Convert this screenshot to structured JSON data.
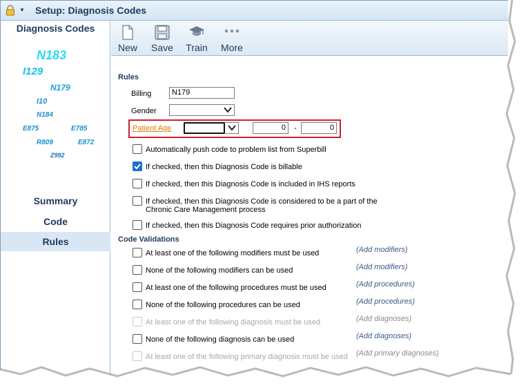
{
  "window": {
    "title": "Setup: Diagnosis Codes"
  },
  "sidebar": {
    "title": "Diagnosis Codes",
    "cloud": [
      {
        "code": "N183",
        "size": 18,
        "color": "#2ed9f0"
      },
      {
        "code": "I129",
        "size": 15,
        "color": "#16c2e8"
      },
      {
        "code": "N179",
        "size": 12,
        "color": "#1aa0d8"
      },
      {
        "code": "I10",
        "size": 11,
        "color": "#1a8fd0"
      },
      {
        "code": "N184",
        "size": 10,
        "color": "#1a8fd0"
      },
      {
        "code": "E875",
        "size": 10,
        "color": "#1a8fd0"
      },
      {
        "code": "E785",
        "size": 10,
        "color": "#1a8fd0"
      },
      {
        "code": "R809",
        "size": 10,
        "color": "#1a8fd0"
      },
      {
        "code": "E872",
        "size": 10,
        "color": "#1a8fd0"
      },
      {
        "code": "Z992",
        "size": 9,
        "color": "#1a6fb8"
      }
    ],
    "nav": [
      {
        "label": "Summary",
        "active": false
      },
      {
        "label": "Code",
        "active": false
      },
      {
        "label": "Rules",
        "active": true
      }
    ]
  },
  "toolbar": {
    "buttons": [
      {
        "label": "New",
        "icon": "new-document-icon"
      },
      {
        "label": "Save",
        "icon": "floppy-disk-icon"
      },
      {
        "label": "Train",
        "icon": "graduation-cap-icon"
      },
      {
        "label": "More",
        "icon": "more-dots-icon"
      }
    ]
  },
  "rules": {
    "heading": "Rules",
    "billing_label": "Billing",
    "billing_value": "N179",
    "gender_label": "Gender",
    "gender_value": "",
    "patient_age_label": "Patient Age",
    "age_unit_value": "",
    "age_min": "0",
    "age_separator": "-",
    "age_max": "0",
    "checkboxes": [
      {
        "label": "Automatically push code to problem list from Superbill",
        "checked": false
      },
      {
        "label": "If checked, then this Diagnosis Code is billable",
        "checked": true
      },
      {
        "label": "If checked, then this Diagnosis Code is included in IHS reports",
        "checked": false
      },
      {
        "label": "If checked, then this Diagnosis Code is considered to be a part of the",
        "label2": "Chronic Care Management process",
        "checked": false
      },
      {
        "label": "If checked, then this Diagnosis Code requires prior authorization",
        "checked": false
      }
    ]
  },
  "validations": {
    "heading": "Code Validations",
    "items": [
      {
        "label": "At least one of the following modifiers must be used",
        "link": "(Add modifiers)",
        "disabled": false
      },
      {
        "label": "None of the following modifiers can be used",
        "link": "(Add modifiers)",
        "disabled": false
      },
      {
        "label": "At least one of the following procedures must be used",
        "link": "(Add procedures)",
        "disabled": false
      },
      {
        "label": "None of the following procedures can be used",
        "link": "(Add procedures)",
        "disabled": false
      },
      {
        "label": "At least one of the following diagnosis must be used",
        "link": "(Add diagnoses)",
        "disabled": true
      },
      {
        "label": "None of the following diagnosis can be used",
        "link": "(Add diagnoses)",
        "disabled": false
      },
      {
        "label": "At least one of the following primary diagnosis must be used",
        "link": "(Add primary diagnoses)",
        "disabled": true
      }
    ]
  },
  "colors": {
    "accent": "#1e3a5f",
    "highlight_box": "#d0202a",
    "link_orange": "#e07b00",
    "checked": "#1e6fd0"
  }
}
